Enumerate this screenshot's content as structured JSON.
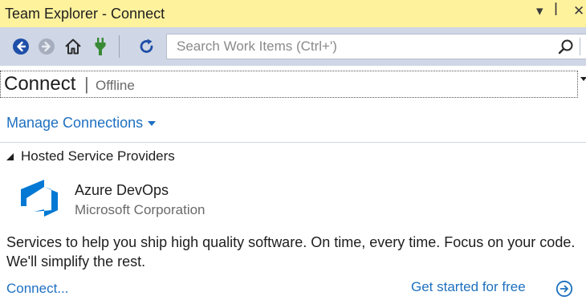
{
  "window": {
    "title": "Team Explorer - Connect",
    "dropdown_icon": "▾",
    "pin_icon": "ꟾ",
    "close_icon": "✕"
  },
  "toolbar": {
    "search_placeholder": "Search Work Items (Ctrl+')",
    "icons": [
      "back-icon",
      "forward-icon",
      "home-icon",
      "plug-icon",
      "refresh-icon",
      "search-icon"
    ]
  },
  "header": {
    "title": "Connect",
    "separator": "|",
    "status": "Offline"
  },
  "manage_connections": "Manage Connections",
  "section": {
    "title": "Hosted Service Providers"
  },
  "provider": {
    "name": "Azure DevOps",
    "company": "Microsoft Corporation",
    "description": "Services to help you ship high quality software. On time, every time. Focus on your code. We'll simplify the rest.",
    "connect_label": "Connect...",
    "get_started_label": "Get started for free"
  },
  "colors": {
    "titlebar": "#fff29d",
    "toolbar": "#cfd6e5",
    "link": "#1e70c0",
    "azure_blue": "#0078d4",
    "plug_green": "#388a34"
  }
}
